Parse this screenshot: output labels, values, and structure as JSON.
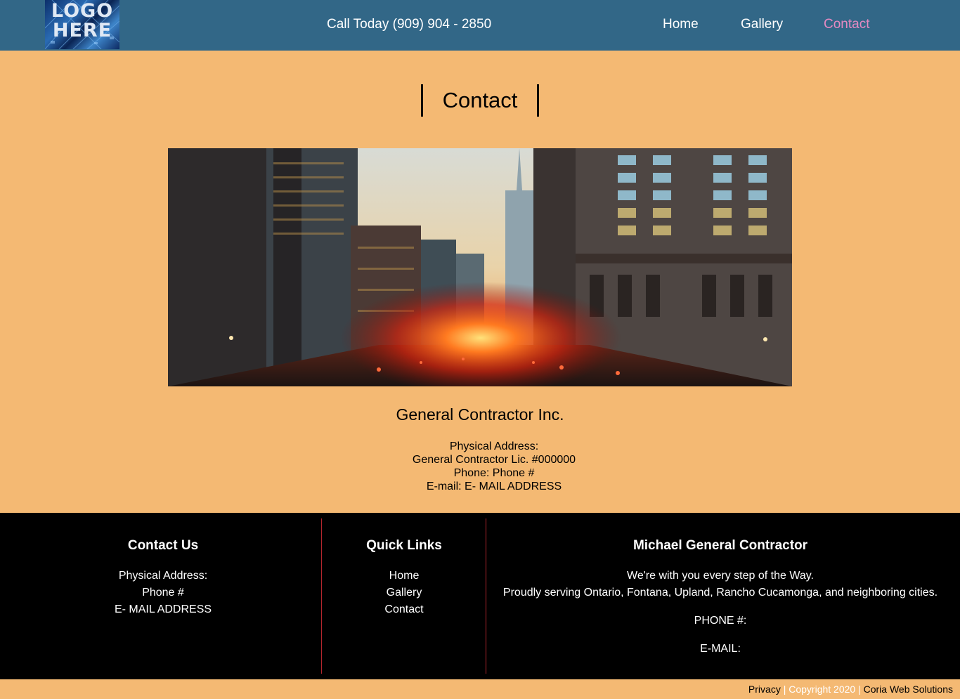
{
  "header": {
    "logo_text_line1": "LOGO",
    "logo_text_line2": "HERE",
    "phone": "Call Today (909) 904 - 2850",
    "nav": [
      {
        "label": "Home"
      },
      {
        "label": "Gallery"
      },
      {
        "label": "Contact",
        "active": true
      }
    ]
  },
  "main": {
    "title": "Contact",
    "company_name": "General Contractor Inc.",
    "info": {
      "address": "Physical Address:",
      "license": "General Contractor Lic. #000000",
      "phone": "Phone: Phone #",
      "email": "E-mail: E- MAIL ADDRESS"
    }
  },
  "footer": {
    "contact": {
      "heading": "Contact Us",
      "address": "Physical Address:",
      "phone": "Phone #",
      "email": "E- MAIL ADDRESS"
    },
    "quick_links": {
      "heading": "Quick Links",
      "links": [
        "Home",
        "Gallery",
        "Contact"
      ]
    },
    "about": {
      "heading": "Michael General Contractor",
      "tagline": "We're with you every step of the Way.",
      "serving": "Proudly serving Ontario, Fontana, Upland, Rancho Cucamonga, and neighboring cities.",
      "phone_label": "PHONE #:",
      "email_label": "E-MAIL:"
    }
  },
  "bottom_bar": {
    "privacy": "Privacy",
    "separator": "|",
    "copyright": "Copyright 2020",
    "credit": "Coria Web Solutions"
  },
  "colors": {
    "header_bg": "#326787",
    "page_bg": "#f4b973",
    "active_nav": "#e58ac2",
    "footer_bg": "#000000",
    "divider": "#b3262d"
  }
}
